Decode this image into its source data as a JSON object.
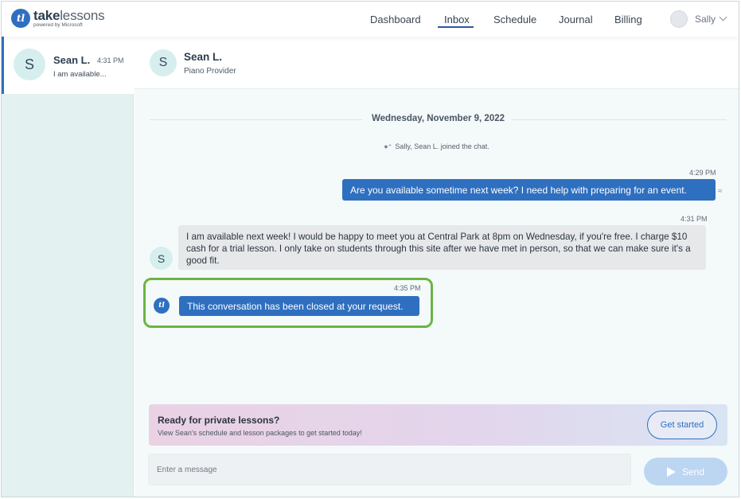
{
  "brand": {
    "logo_mark": "tl",
    "name_bold": "take",
    "name_rest": "lessons",
    "tagline": "powered by Microsoft"
  },
  "nav": {
    "items": [
      "Dashboard",
      "Inbox",
      "Schedule",
      "Journal",
      "Billing"
    ],
    "active": "Inbox",
    "user_name": "Sally"
  },
  "sidebar": {
    "conversations": [
      {
        "initial": "S",
        "name": "Sean L.",
        "time": "4:31 PM",
        "preview": "I am available..."
      }
    ]
  },
  "chat": {
    "header": {
      "initial": "S",
      "name": "Sean L.",
      "subtitle": "Piano Provider"
    },
    "date": "Wednesday, November 9, 2022",
    "system_message": "Sally, Sean L. joined the chat.",
    "messages": [
      {
        "from": "me",
        "time": "4:29 PM",
        "text": "Are you available sometime next week? I need help with preparing for an event."
      },
      {
        "from": "Sean L.",
        "initial": "S",
        "time": "4:31 PM",
        "text": "I am available next week! I would be happy to meet you at Central Park at 8pm on Wednesday, if you're free. I charge $10 cash for a trial lesson. I only take on students through this site after we have met in person, so that we can make sure it's a good fit."
      },
      {
        "from": "system",
        "time": "4:35 PM",
        "text": "This conversation has been closed at your request."
      }
    ],
    "highlight_color": "#6cb443"
  },
  "promo": {
    "title": "Ready for private lessons?",
    "subtitle": "View Sean's schedule and lesson packages to get started today!",
    "button_label": "Get started"
  },
  "composer": {
    "placeholder": "Enter a message",
    "value": "",
    "send_label": "Send"
  },
  "colors": {
    "accent": "#2f6fc0",
    "sidebar_bg": "#e3f1f1",
    "incoming_bubble": "#e6e8ea",
    "send_disabled": "#bcd6f2"
  }
}
